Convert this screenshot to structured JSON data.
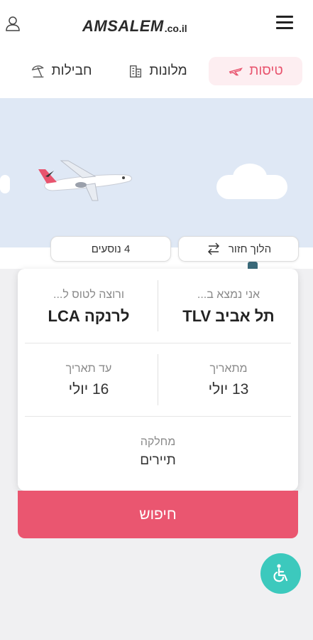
{
  "header": {
    "logo_main": "AMSALEM",
    "logo_suffix": ".co.il",
    "icons": [
      "user-icon",
      "hamburger-menu-icon"
    ]
  },
  "tabs": [
    {
      "label": "טיסות",
      "icon": "plane-icon",
      "active": true
    },
    {
      "label": "מלונות",
      "icon": "hotel-icon",
      "active": false
    },
    {
      "label": "חבילות",
      "icon": "beach-umbrella-icon",
      "active": false
    }
  ],
  "trip": {
    "roundtrip_label": "הלוך חזור",
    "passengers_label": "4 נוסעים"
  },
  "search_form": {
    "origin_label": "אני נמצא ב...",
    "origin_value": "תל אביב TLV",
    "destination_label": "ורוצה לטוס ל...",
    "destination_value": "לרנקה LCA",
    "from_date_label": "מתאריך",
    "from_date_value": "13 יולי",
    "to_date_label": "עד תאריך",
    "to_date_value": "16 יולי",
    "class_label": "מחלקה",
    "class_value": "תיירים"
  },
  "search_button": "חיפוש",
  "colors": {
    "accent": "#ea5670",
    "active_tab_bg": "#fdeef1",
    "hero_bg": "#dfe8f5",
    "accessibility": "#3cc9bd"
  }
}
